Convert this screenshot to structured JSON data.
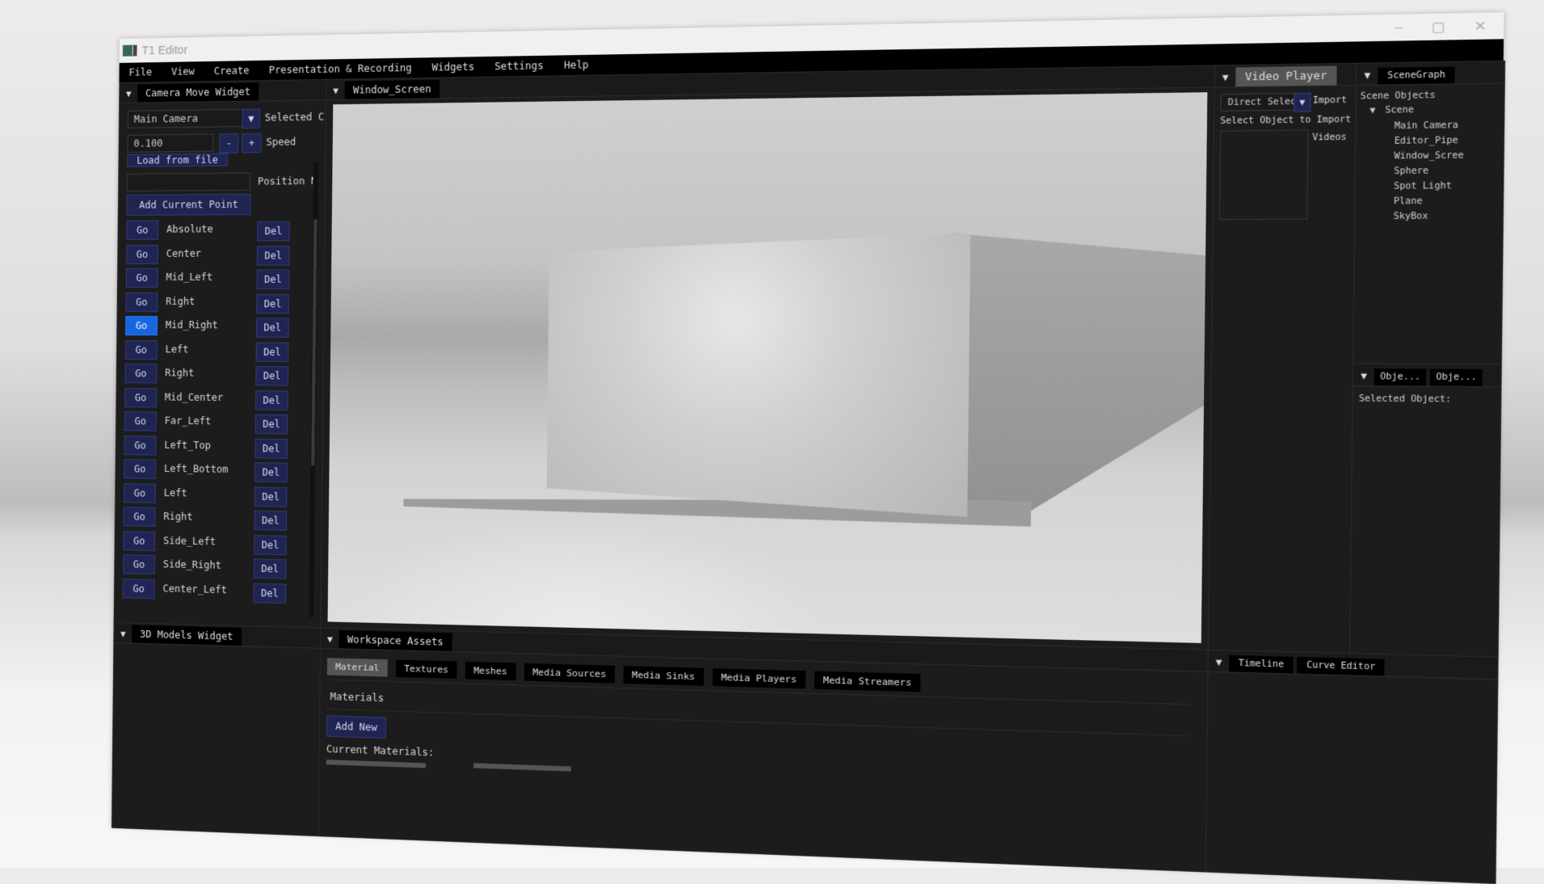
{
  "window": {
    "title": "T1 Editor",
    "controls": {
      "minimize": "–",
      "maximize": "▢",
      "close": "✕"
    }
  },
  "menu": [
    "File",
    "View",
    "Create",
    "Presentation & Recording",
    "Widgets",
    "Settings",
    "Help"
  ],
  "camera_widget": {
    "tab": "Camera Move Widget",
    "camera_select": "Main Camera",
    "camera_select_label": "Selected C",
    "speed_value": "0.100",
    "speed_minus": "-",
    "speed_plus": "+",
    "speed_label": "Speed",
    "load_from_file": "Load from file",
    "position_name_value": "",
    "position_name_label": "Position N",
    "add_current_point": "Add Current Point",
    "go_label": "Go",
    "del_label": "Del",
    "highlighted_index": 4,
    "points": [
      "Absolute",
      "Center",
      "Mid_Left",
      "Right",
      "Mid_Right",
      "Left",
      "Right",
      "Mid_Center",
      "Far_Left",
      "Left_Top",
      "Left_Bottom",
      "Left",
      "Right",
      "Side_Left",
      "Side_Right",
      "Center_Left"
    ]
  },
  "models_widget": {
    "tab": "3D Models Widget"
  },
  "viewport": {
    "tab": "Window_Screen"
  },
  "video_player": {
    "tab": "Video Player",
    "select_value": "Direct Selec",
    "import_label": "Import",
    "select_object_label": "Select Object to Import",
    "videos_label": "Videos"
  },
  "scenegraph": {
    "tab": "SceneGraph",
    "header": "Scene Objects",
    "root": "Scene",
    "objects": [
      "Main Camera",
      "Editor_Pipe",
      "Window_Scree",
      "Sphere",
      "Spot Light",
      "Plane",
      "SkyBox"
    ]
  },
  "object_panel": {
    "tabs": [
      "Obje...",
      "Obje..."
    ],
    "selected_label": "Selected Object:"
  },
  "timeline": {
    "tabs": [
      "Timeline",
      "Curve Editor"
    ]
  },
  "workspace_assets": {
    "tab": "Workspace Assets",
    "tabs": [
      "Material",
      "Textures",
      "Meshes",
      "Media Sources",
      "Media Sinks",
      "Media Players",
      "Media Streamers"
    ],
    "active_tab": "Material",
    "section_label": "Materials",
    "add_new": "Add New",
    "current_label": "Current Materials:"
  },
  "colors": {
    "button_bg": "#1f2452",
    "button_active": "#1766e0",
    "panel_bg": "#1c1c1c"
  }
}
